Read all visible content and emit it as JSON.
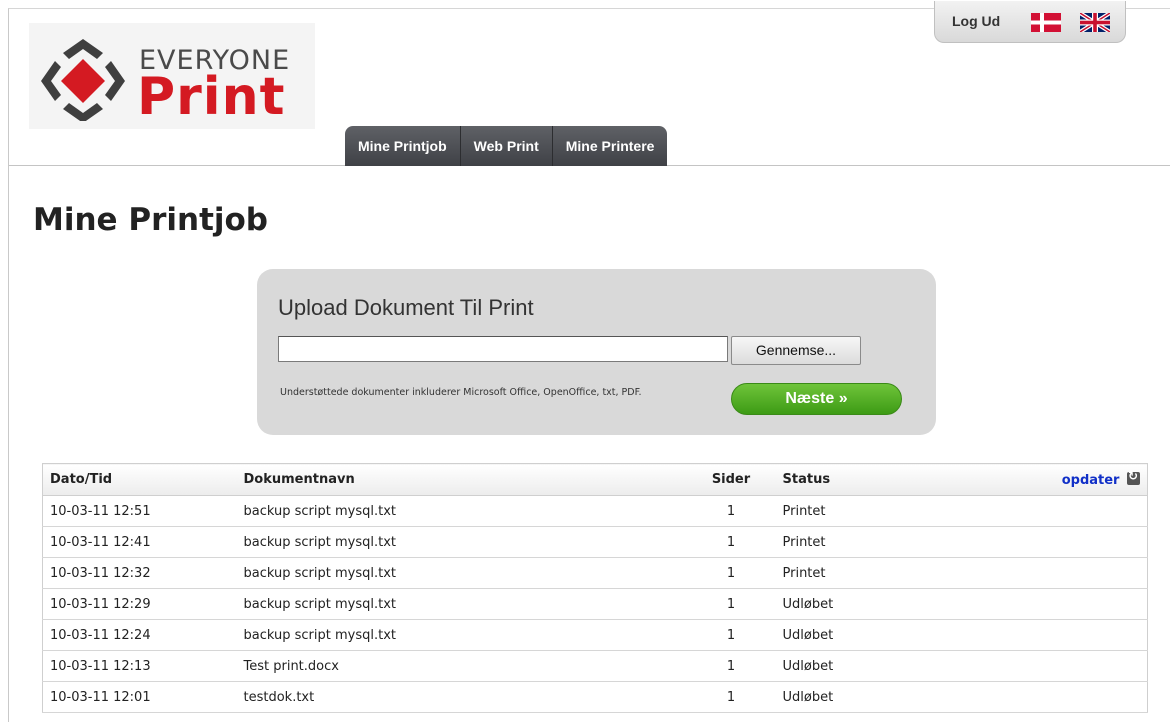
{
  "brand": {
    "top_word": "EVERYONE",
    "main_word": "Print",
    "colors": {
      "red": "#d41a22",
      "grey": "#4a4a4a"
    }
  },
  "topbar": {
    "logout_label": "Log Ud",
    "flags": [
      "danish-flag-icon",
      "uk-flag-icon"
    ]
  },
  "nav": {
    "items": [
      {
        "label": "Mine Printjob"
      },
      {
        "label": "Web Print"
      },
      {
        "label": "Mine Printere"
      }
    ]
  },
  "page": {
    "title": "Mine Printjob"
  },
  "upload": {
    "title": "Upload Dokument Til Print",
    "file_value": "",
    "browse_label": "Gennemse...",
    "supported_text": "Understøttede dokumenter inkluderer Microsoft Office, OpenOffice, txt, PDF.",
    "next_label": "Næste »",
    "next_color": "#4aab1f"
  },
  "table": {
    "headers": {
      "date": "Dato/Tid",
      "document": "Dokumentnavn",
      "pages": "Sider",
      "status": "Status",
      "refresh": "opdater"
    },
    "rows": [
      {
        "date": "10-03-11 12:51",
        "document": "backup script mysql.txt",
        "pages": "1",
        "status": "Printet"
      },
      {
        "date": "10-03-11 12:41",
        "document": "backup script mysql.txt",
        "pages": "1",
        "status": "Printet"
      },
      {
        "date": "10-03-11 12:32",
        "document": "backup script mysql.txt",
        "pages": "1",
        "status": "Printet"
      },
      {
        "date": "10-03-11 12:29",
        "document": "backup script mysql.txt",
        "pages": "1",
        "status": "Udløbet"
      },
      {
        "date": "10-03-11 12:24",
        "document": "backup script mysql.txt",
        "pages": "1",
        "status": "Udløbet"
      },
      {
        "date": "10-03-11 12:13",
        "document": "Test print.docx",
        "pages": "1",
        "status": "Udløbet"
      },
      {
        "date": "10-03-11 12:01",
        "document": "testdok.txt",
        "pages": "1",
        "status": "Udløbet"
      }
    ]
  }
}
